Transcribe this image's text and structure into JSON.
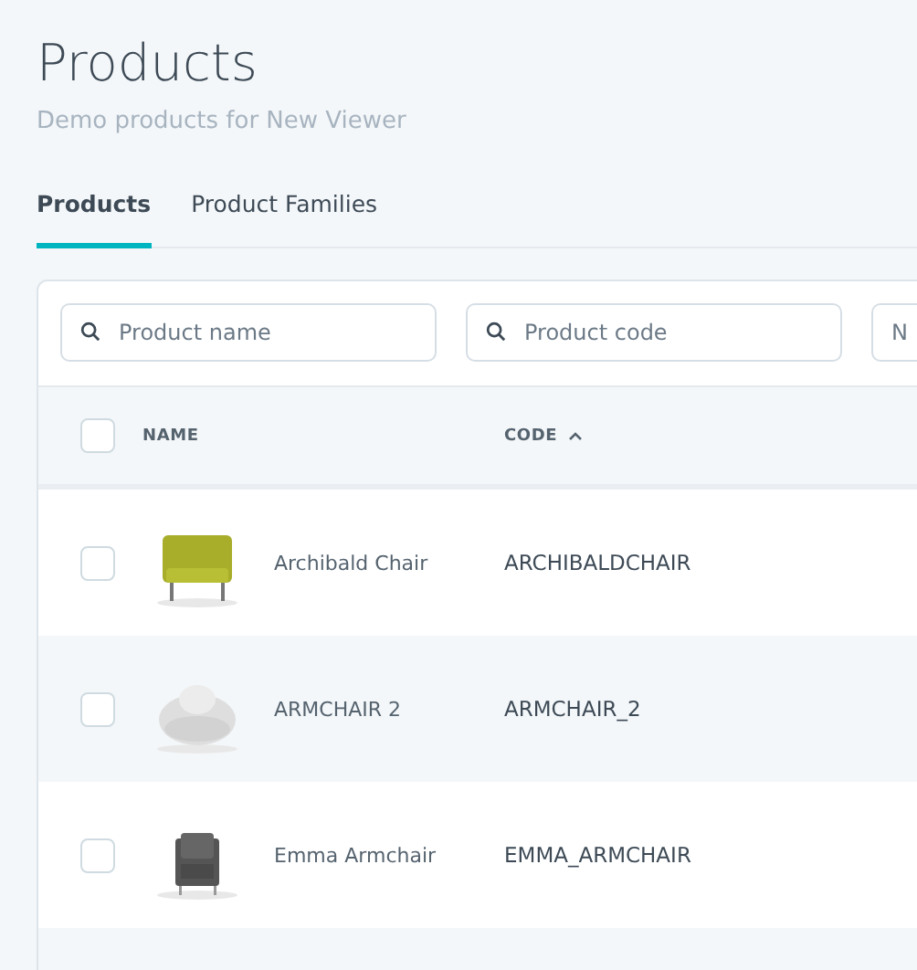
{
  "page": {
    "title": "Products",
    "subtitle": "Demo products for New Viewer"
  },
  "tabs": [
    {
      "label": "Products",
      "selected": true
    },
    {
      "label": "Product Families",
      "selected": false
    }
  ],
  "filters": [
    {
      "placeholder": "Product name",
      "search": true
    },
    {
      "placeholder": "Product code",
      "search": true
    },
    {
      "placeholder": "N",
      "search": false
    }
  ],
  "table": {
    "select_all": {
      "checked": false
    },
    "columns": [
      {
        "label": "NAME",
        "sorted": false
      },
      {
        "label": "CODE",
        "sorted": true
      }
    ],
    "rows": [
      {
        "checked": false,
        "name": "Archibald Chair",
        "code": "ARCHIBALDCHAIR"
      },
      {
        "checked": false,
        "name": "ARMCHAIR 2",
        "code": "ARMCHAIR_2"
      },
      {
        "checked": false,
        "name": "Emma Armchair",
        "code": "EMMA_ARMCHAIR"
      }
    ]
  }
}
